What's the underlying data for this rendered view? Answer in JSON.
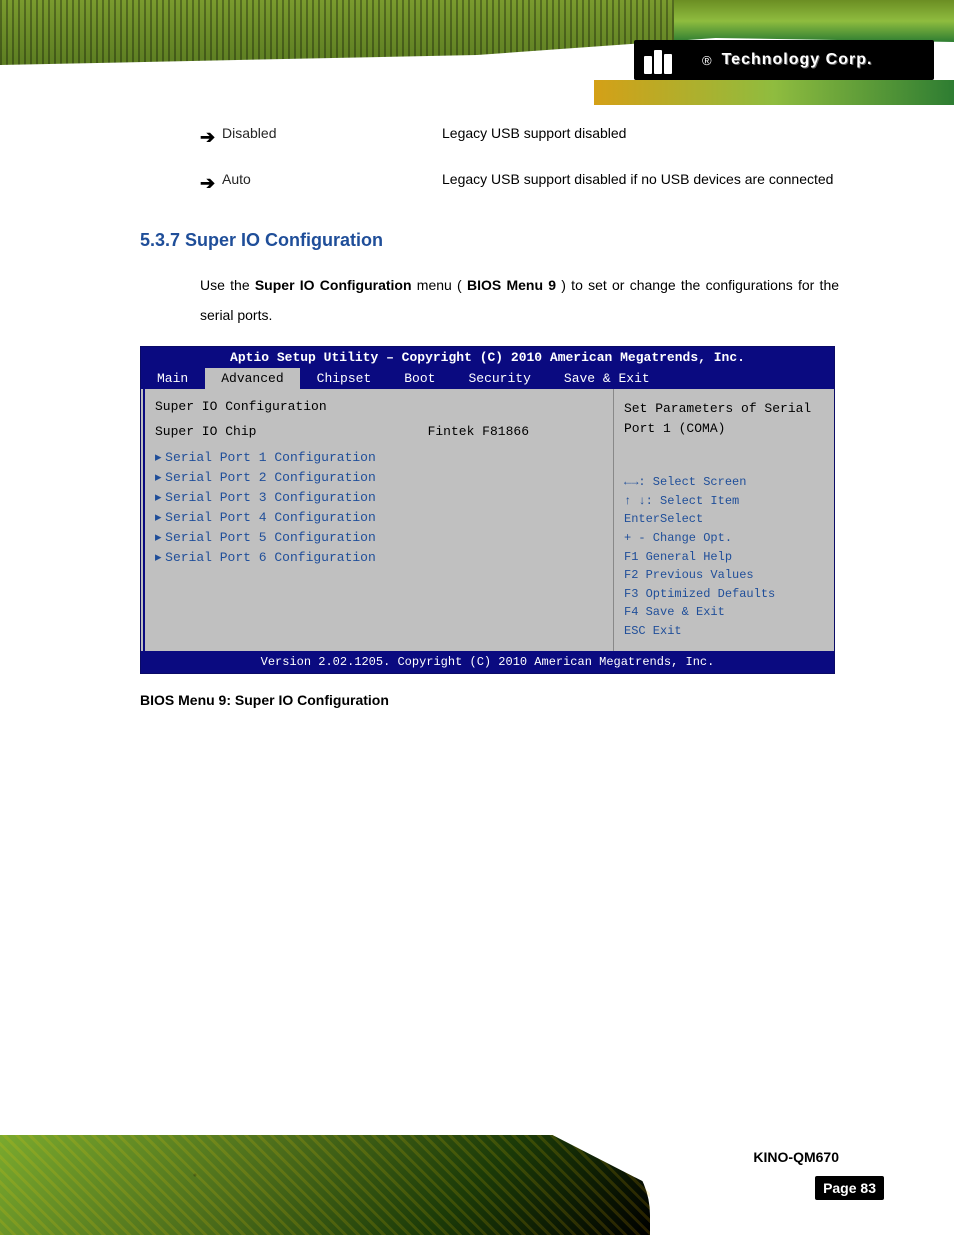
{
  "header": {
    "logo_text": "Technology Corp."
  },
  "bullets": [
    {
      "label": "Disabled",
      "desc": "Legacy USB support disabled"
    },
    {
      "label": "Auto",
      "desc": "Legacy USB support disabled if no USB devices are connected"
    }
  ],
  "section": {
    "heading": "5.3.7 Super IO Configuration",
    "para_prefix": "Use the ",
    "para_bold1": "Super IO Configuration",
    "para_mid": " menu (",
    "para_bold2": "BIOS Menu 9",
    "para_suffix": ") to set or change the configurations for the serial ports."
  },
  "bios": {
    "title": "Aptio Setup Utility – Copyright (C) 2010 American Megatrends, Inc.",
    "tabs": [
      "Main",
      "Advanced",
      "Chipset",
      "Boot",
      "Security",
      "Save & Exit"
    ],
    "active_tab_index": 1,
    "left_heading": "Super IO Configuration",
    "chip_label": "Super IO Chip",
    "chip_value": "Fintek F81866",
    "items": [
      "Serial Port 1 Configuration",
      "Serial Port 2 Configuration",
      "Serial Port 3 Configuration",
      "Serial Port 4 Configuration",
      "Serial Port 5 Configuration",
      "Serial Port 6 Configuration"
    ],
    "right_hint": "Set Parameters of Serial Port 1 (COMA)",
    "nav_lines": [
      "←→: Select Screen",
      "↑ ↓: Select Item",
      "EnterSelect",
      "+ - Change Opt.",
      "F1  General Help",
      "F2  Previous Values",
      "F3  Optimized Defaults",
      "F4  Save & Exit",
      "ESC Exit"
    ],
    "footer": "Version 2.02.1205. Copyright (C) 2010 American Megatrends, Inc."
  },
  "caption": "BIOS Menu 9: Super IO Configuration",
  "footer": {
    "product": "KINO-QM670",
    "page": "Page 83"
  }
}
